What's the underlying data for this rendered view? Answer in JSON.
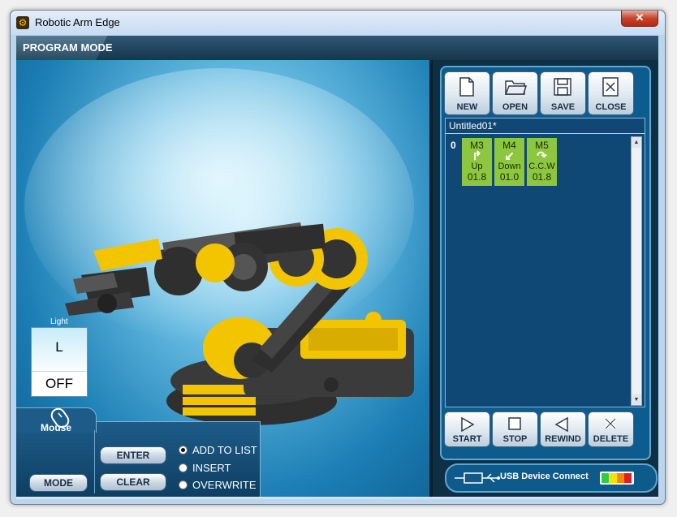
{
  "window": {
    "title": "Robotic Arm Edge",
    "close_glyph": "✕",
    "app_icon": "robotic-arm-app-icon"
  },
  "header": {
    "mode_label": "PROGRAM MODE"
  },
  "light": {
    "label": "Light",
    "key": "L",
    "state": "OFF"
  },
  "mouse": {
    "label": "Mouse",
    "mode_button": "MODE"
  },
  "controls": {
    "enter_label": "ENTER",
    "clear_label": "CLEAR",
    "radios": [
      {
        "label": "ADD TO LIST",
        "checked": true
      },
      {
        "label": "INSERT",
        "checked": false
      },
      {
        "label": "OVERWRITE",
        "checked": false
      }
    ]
  },
  "file_toolbar": [
    {
      "label": "NEW",
      "icon": "new-file-icon"
    },
    {
      "label": "OPEN",
      "icon": "open-folder-icon"
    },
    {
      "label": "SAVE",
      "icon": "save-disk-icon"
    },
    {
      "label": "CLOSE",
      "icon": "close-box-icon"
    }
  ],
  "program": {
    "title": "Untitled01*",
    "row_index": "0",
    "steps": [
      {
        "motor": "M3",
        "arrow": "↱",
        "direction": "Up",
        "time": "01.8"
      },
      {
        "motor": "M4",
        "arrow": "↙",
        "direction": "Down",
        "time": "01.0"
      },
      {
        "motor": "M5",
        "arrow": "↷",
        "direction": "C.C.W",
        "time": "01.8"
      }
    ]
  },
  "playback_toolbar": [
    {
      "label": "START",
      "icon": "play-icon"
    },
    {
      "label": "STOP",
      "icon": "stop-icon"
    },
    {
      "label": "REWIND",
      "icon": "rewind-icon"
    },
    {
      "label": "DELETE",
      "icon": "delete-x-icon"
    }
  ],
  "usb": {
    "label": "USB Device Connect",
    "battery_colors": [
      "#2ecc40",
      "#f2e300",
      "#f08a00",
      "#e02020"
    ]
  }
}
